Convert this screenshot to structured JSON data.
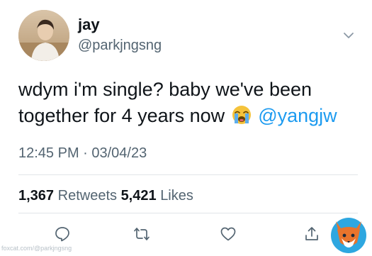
{
  "user": {
    "display_name": "jay",
    "handle": "@parkjngsng"
  },
  "tweet": {
    "text_before": "wdym i'm single? baby we've been together for 4 years now",
    "emoji": "loudly-crying-face",
    "mention": "@yangjw"
  },
  "meta": {
    "timestamp": "12:45 PM · 03/04/23"
  },
  "stats": {
    "retweets_count": "1,367",
    "retweets_label": "Retweets",
    "likes_count": "5,421",
    "likes_label": "Likes"
  },
  "actions": [
    "reply-icon",
    "retweet-icon",
    "like-icon",
    "share-icon"
  ],
  "icons": {
    "menu": "chevron-down-icon"
  },
  "watermark": {
    "text": "foxcat.com/@parkjngsng"
  },
  "colors": {
    "accent": "#1d9bf0",
    "secondary_text": "#536471",
    "primary_text": "#0f1419",
    "divider": "#e1e5e8"
  }
}
